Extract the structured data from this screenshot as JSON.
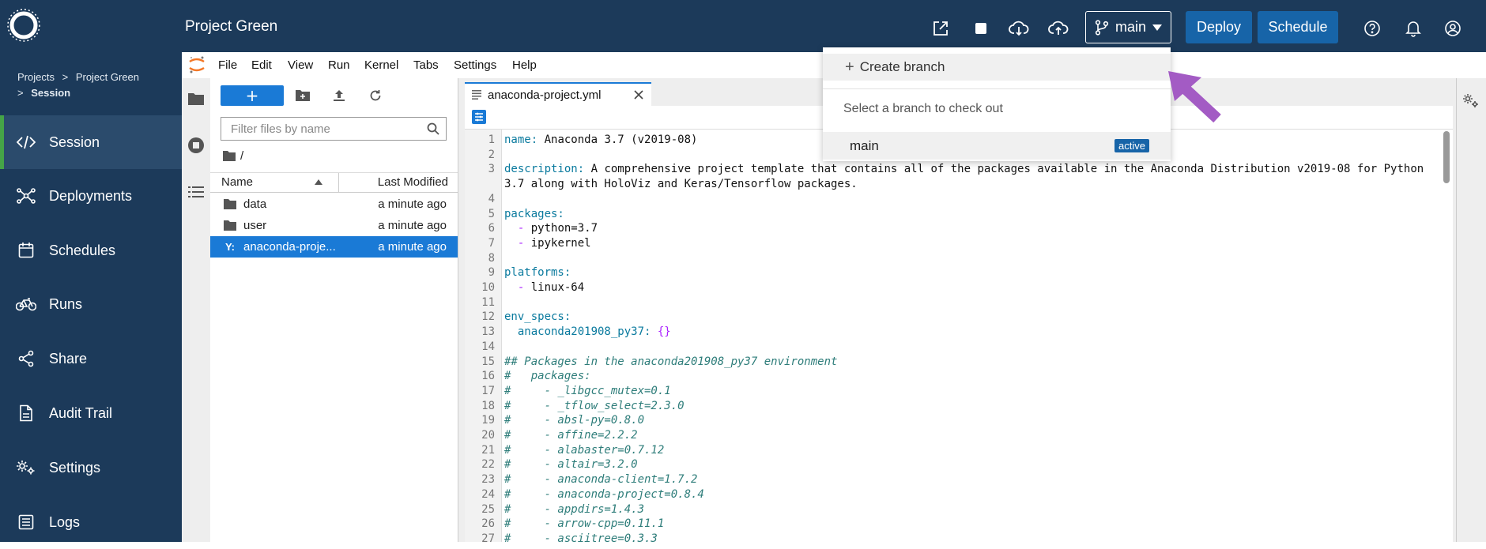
{
  "header": {
    "project_title": "Project Green",
    "branch_label": "main",
    "deploy_label": "Deploy",
    "schedule_label": "Schedule"
  },
  "breadcrumb": {
    "projects": "Projects",
    "separator": ">",
    "project": "Project Green",
    "current": "Session"
  },
  "nav": {
    "items": [
      {
        "label": "Session",
        "icon": "code-icon"
      },
      {
        "label": "Deployments",
        "icon": "network-icon"
      },
      {
        "label": "Schedules",
        "icon": "calendar-icon"
      },
      {
        "label": "Runs",
        "icon": "bicycle-icon"
      },
      {
        "label": "Share",
        "icon": "share-icon"
      },
      {
        "label": "Audit Trail",
        "icon": "document-icon"
      },
      {
        "label": "Settings",
        "icon": "gears-icon"
      },
      {
        "label": "Logs",
        "icon": "logs-icon"
      }
    ],
    "active": "Session"
  },
  "menubar": {
    "items": [
      "File",
      "Edit",
      "View",
      "Run",
      "Kernel",
      "Tabs",
      "Settings",
      "Help"
    ]
  },
  "filebrowser": {
    "new_label": "+",
    "search_placeholder": "Filter files by name",
    "path": "/",
    "columns": {
      "name": "Name",
      "modified": "Last Modified"
    },
    "rows": [
      {
        "icon": "folder-icon",
        "name": "data",
        "modified": "a minute ago"
      },
      {
        "icon": "folder-icon",
        "name": "user",
        "modified": "a minute ago"
      },
      {
        "icon": "yaml-icon",
        "icon_text": "Y:",
        "name": "anaconda-proje...",
        "modified": "a minute ago"
      }
    ]
  },
  "editor": {
    "tab_title": "anaconda-project.yml",
    "lines": [
      {
        "n": "1",
        "parts": [
          [
            "k",
            "name:"
          ],
          [
            "t",
            " Anaconda 3.7 (v2019-08)"
          ]
        ]
      },
      {
        "n": "2",
        "parts": []
      },
      {
        "n": "3",
        "parts": [
          [
            "k",
            "description:"
          ],
          [
            "t",
            " A comprehensive project template that contains all of the packages available in the Anaconda Distribution v2019-08 for Python"
          ]
        ]
      },
      {
        "n": "",
        "parts": [
          [
            "t",
            "3.7 along with HoloViz and Keras/Tensorflow packages."
          ]
        ]
      },
      {
        "n": "4",
        "parts": []
      },
      {
        "n": "5",
        "parts": [
          [
            "k",
            "packages:"
          ]
        ]
      },
      {
        "n": "6",
        "parts": [
          [
            "t",
            "  "
          ],
          [
            "s",
            "-"
          ],
          [
            "t",
            " python=3.7"
          ]
        ]
      },
      {
        "n": "7",
        "parts": [
          [
            "t",
            "  "
          ],
          [
            "s",
            "-"
          ],
          [
            "t",
            " ipykernel"
          ]
        ]
      },
      {
        "n": "8",
        "parts": []
      },
      {
        "n": "9",
        "parts": [
          [
            "k",
            "platforms:"
          ]
        ]
      },
      {
        "n": "10",
        "parts": [
          [
            "t",
            "  "
          ],
          [
            "s",
            "-"
          ],
          [
            "t",
            " linux-64"
          ]
        ]
      },
      {
        "n": "11",
        "parts": []
      },
      {
        "n": "12",
        "parts": [
          [
            "k",
            "env_specs:"
          ]
        ]
      },
      {
        "n": "13",
        "parts": [
          [
            "t",
            "  "
          ],
          [
            "k",
            "anaconda201908_py37:"
          ],
          [
            "t",
            " "
          ],
          [
            "s",
            "{}"
          ]
        ]
      },
      {
        "n": "14",
        "parts": []
      },
      {
        "n": "15",
        "parts": [
          [
            "c",
            "## Packages in the anaconda201908_py37 environment"
          ]
        ]
      },
      {
        "n": "16",
        "parts": [
          [
            "c",
            "#   packages:"
          ]
        ]
      },
      {
        "n": "17",
        "parts": [
          [
            "c",
            "#     - _libgcc_mutex=0.1"
          ]
        ]
      },
      {
        "n": "18",
        "parts": [
          [
            "c",
            "#     - _tflow_select=2.3.0"
          ]
        ]
      },
      {
        "n": "19",
        "parts": [
          [
            "c",
            "#     - absl-py=0.8.0"
          ]
        ]
      },
      {
        "n": "20",
        "parts": [
          [
            "c",
            "#     - affine=2.2.2"
          ]
        ]
      },
      {
        "n": "21",
        "parts": [
          [
            "c",
            "#     - alabaster=0.7.12"
          ]
        ]
      },
      {
        "n": "22",
        "parts": [
          [
            "c",
            "#     - altair=3.2.0"
          ]
        ]
      },
      {
        "n": "23",
        "parts": [
          [
            "c",
            "#     - anaconda-client=1.7.2"
          ]
        ]
      },
      {
        "n": "24",
        "parts": [
          [
            "c",
            "#     - anaconda-project=0.8.4"
          ]
        ]
      },
      {
        "n": "25",
        "parts": [
          [
            "c",
            "#     - appdirs=1.4.3"
          ]
        ]
      },
      {
        "n": "26",
        "parts": [
          [
            "c",
            "#     - arrow-cpp=0.11.1"
          ]
        ]
      },
      {
        "n": "27",
        "parts": [
          [
            "c",
            "#     - asciitree=0.3.3"
          ]
        ]
      }
    ]
  },
  "branch_dropdown": {
    "create_label": "Create branch",
    "create_prefix": "+",
    "hint": "Select a branch to check out",
    "branches": [
      {
        "name": "main",
        "badge": "active"
      }
    ]
  },
  "colors": {
    "topbar": "#1c3a5a",
    "accent_blue": "#1764a8",
    "active_nav_marker": "#45a447",
    "selection_blue": "#1a7ad6",
    "annotation_arrow": "#a35bc4"
  }
}
